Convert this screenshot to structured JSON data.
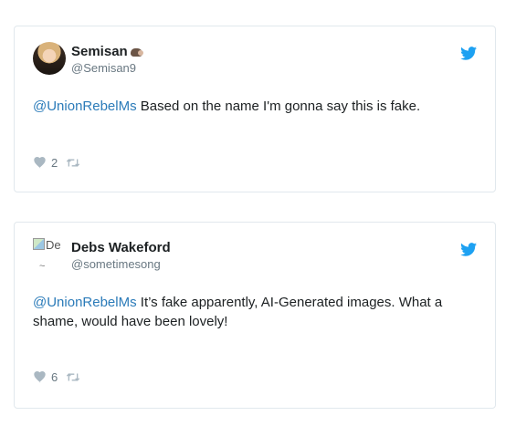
{
  "tweets": [
    {
      "display_name": "Semisan",
      "name_emoji": "mouse-emoji",
      "handle": "@Semisan9",
      "avatar": "photo",
      "mention": "@UnionRebelMs",
      "text": " Based on the name I'm gonna say this is fake.",
      "likes": "2"
    },
    {
      "display_name": "Debs Wakeford",
      "handle": "@sometimesong",
      "avatar": "broken-image",
      "avatar_alt": "De",
      "avatar_alt_under": "~",
      "mention": "@UnionRebelMs",
      "text": " It’s fake apparently, AI-Generated images. What a shame, would have been lovely!",
      "likes": "6"
    }
  ],
  "colors": {
    "link": "#2b7bb9",
    "twitter_blue": "#1da1f2",
    "meta_gray": "#697882",
    "border": "#e1e8ed"
  },
  "icons": [
    "twitter-bird-icon",
    "heart-icon",
    "retweet-icon"
  ]
}
